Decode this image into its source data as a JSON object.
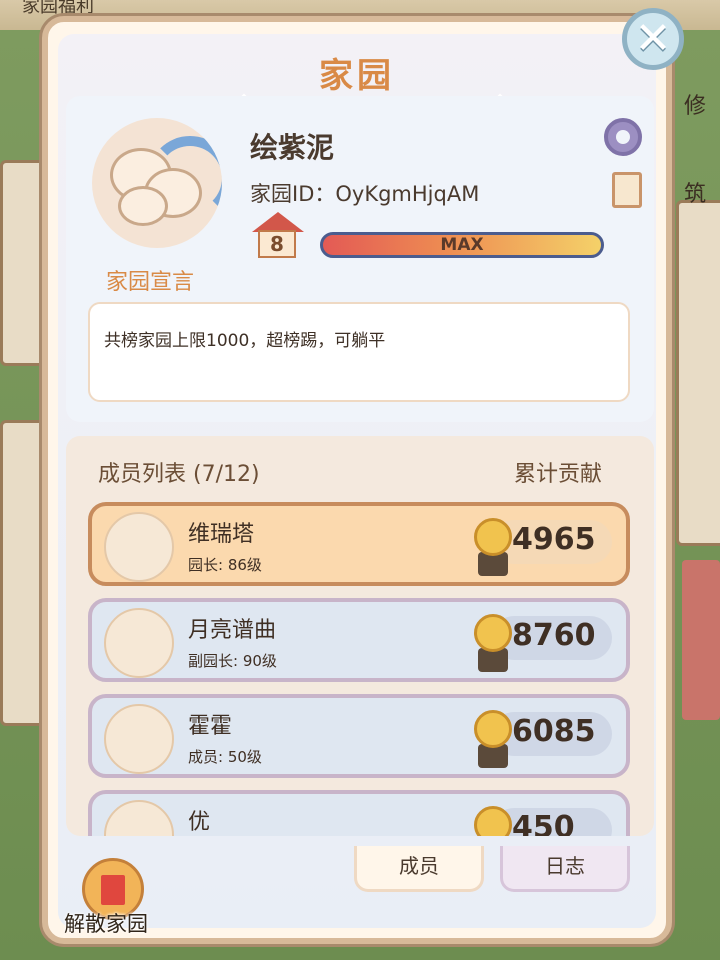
{
  "background": {
    "top_text": "家园福利",
    "side_text_1": "修",
    "side_text_2": "筑"
  },
  "panel": {
    "title": "家园",
    "close_icon": "close-icon"
  },
  "profile": {
    "name": "绘紫泥",
    "home_id": "家园ID：OyKgmHjqAM",
    "level": "8",
    "level_bar_text": "MAX",
    "motto_label": "家园宣言",
    "motto_text": "共榜家园上限1000，超榜踢，可躺平"
  },
  "members": {
    "header": "成员列表 (7/12)",
    "contribution_header": "累计贡献",
    "list": [
      {
        "name": "维瑞塔",
        "role": "园长: 86级",
        "score": "4965"
      },
      {
        "name": "月亮谱曲",
        "role": "副园长: 90级",
        "score": "8760"
      },
      {
        "name": "霍霍",
        "role": "成员: 50级",
        "score": "6085"
      },
      {
        "name": "优",
        "role": "",
        "score": "450"
      }
    ]
  },
  "tabs": {
    "members": "成员",
    "log": "日志"
  },
  "actions": {
    "dissolve": "解散家园"
  },
  "colors": {
    "accent": "#d98a46",
    "leader_bg": "#fbd9ae"
  }
}
